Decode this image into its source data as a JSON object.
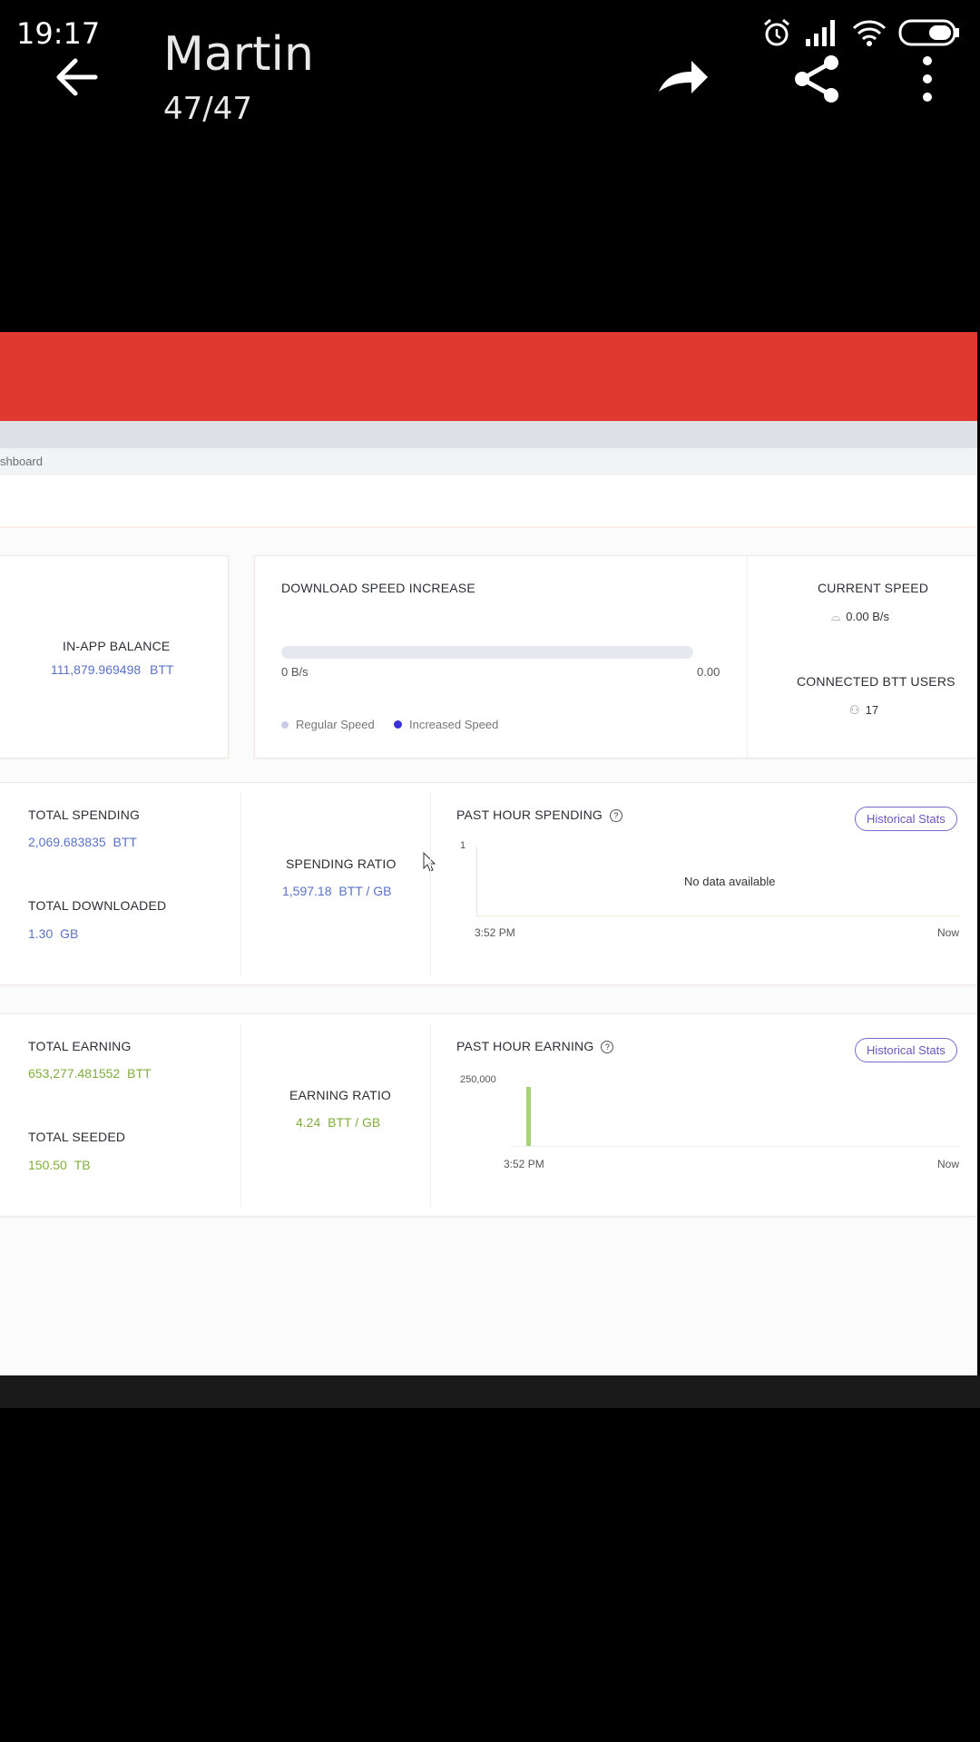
{
  "status_bar": {
    "time": "19:17"
  },
  "viewer": {
    "title": "Martin",
    "counter": "47/47"
  },
  "page": {
    "breadcrumb": "shboard"
  },
  "balance": {
    "label": "IN-APP BALANCE",
    "value": "111,879.969498",
    "unit": "BTT"
  },
  "download": {
    "title": "DOWNLOAD SPEED INCREASE",
    "left_value": "0 B/s",
    "right_value": "0.00",
    "legend_regular": "Regular Speed",
    "legend_increased": "Increased Speed"
  },
  "current_speed": {
    "label": "CURRENT SPEED",
    "value": "0.00 B/s"
  },
  "connected_users": {
    "label": "CONNECTED BTT USERS",
    "value": "17"
  },
  "spending": {
    "total_label": "TOTAL SPENDING",
    "total_value": "2,069.683835",
    "total_unit": "BTT",
    "downloaded_label": "TOTAL DOWNLOADED",
    "downloaded_value": "1.30",
    "downloaded_unit": "GB",
    "ratio_label": "SPENDING RATIO",
    "ratio_value": "1,597.18",
    "ratio_unit": "BTT / GB",
    "chart_title": "PAST HOUR SPENDING",
    "hist_button": "Historical Stats",
    "y_tick": "1",
    "no_data": "No data available",
    "x_start": "3:52 PM",
    "x_end": "Now"
  },
  "earning": {
    "total_label": "TOTAL EARNING",
    "total_value": "653,277.481552",
    "total_unit": "BTT",
    "seeded_label": "TOTAL SEEDED",
    "seeded_value": "150.50",
    "seeded_unit": "TB",
    "ratio_label": "EARNING RATIO",
    "ratio_value": "4.24",
    "ratio_unit": "BTT / GB",
    "chart_title": "PAST HOUR EARNING",
    "hist_button": "Historical Stats",
    "y_tick": "250,000",
    "x_start": "3:52 PM",
    "x_end": "Now"
  },
  "colors": {
    "red_header": "#e03a2e",
    "accent_blue": "#5a72c9",
    "accent_green": "#7fae3d",
    "bar_green": "#a8d27a"
  }
}
